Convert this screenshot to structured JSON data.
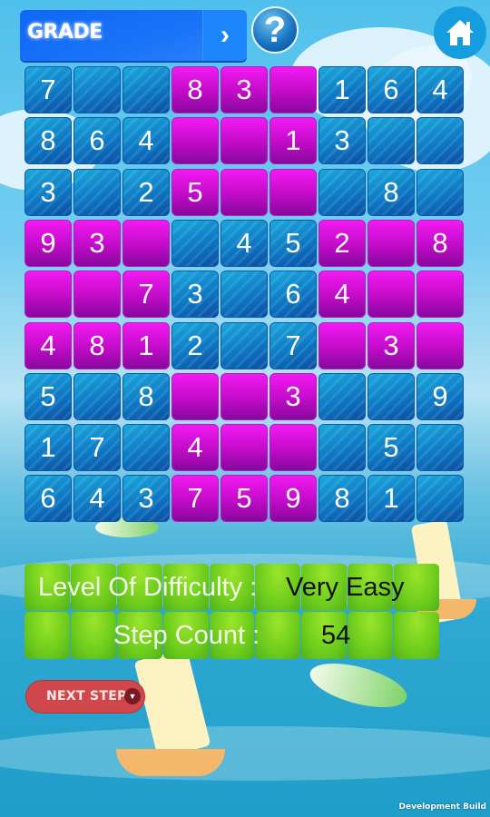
{
  "header": {
    "grade_label": "GRADE",
    "grade_next_icon": "chevron-right-icon",
    "help_icon": "question-mark-icon",
    "home_icon": "home-icon"
  },
  "board": {
    "colors": {
      "blue": "#0c74c2",
      "magenta": "#c10bc8"
    },
    "rows": [
      [
        "7",
        "",
        "",
        "8",
        "3",
        "",
        "1",
        "6",
        "4"
      ],
      [
        "8",
        "6",
        "4",
        "",
        "",
        "1",
        "3",
        "",
        ""
      ],
      [
        "3",
        "",
        "2",
        "5",
        "",
        "",
        "",
        "8",
        ""
      ],
      [
        "9",
        "3",
        "",
        "",
        "4",
        "5",
        "2",
        "",
        "8"
      ],
      [
        "",
        "",
        "7",
        "3",
        "",
        "6",
        "4",
        "",
        ""
      ],
      [
        "4",
        "8",
        "1",
        "2",
        "",
        "7",
        "",
        "3",
        ""
      ],
      [
        "5",
        "",
        "8",
        "",
        "",
        "3",
        "",
        "",
        "9"
      ],
      [
        "1",
        "7",
        "",
        "4",
        "",
        "",
        "",
        "5",
        ""
      ],
      [
        "6",
        "4",
        "3",
        "7",
        "5",
        "9",
        "8",
        "1",
        ""
      ]
    ]
  },
  "info": {
    "difficulty_label": "Level Of Difficulty :",
    "difficulty_value": "Very Easy",
    "step_label": "Step Count :",
    "step_value": "54"
  },
  "next_step": {
    "label": "NEXT STEP",
    "icon": "caret-down-icon"
  },
  "footer": {
    "dev_build": "Development Build"
  }
}
